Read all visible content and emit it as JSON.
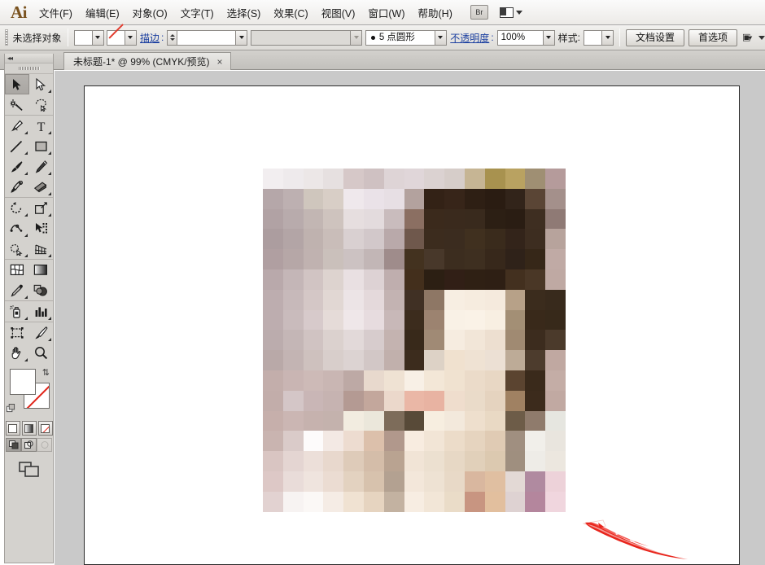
{
  "app": {
    "name": "Ai",
    "logo_text": "Ai"
  },
  "menubar": {
    "items": [
      {
        "label": "文件(F)",
        "name": "menu-file"
      },
      {
        "label": "编辑(E)",
        "name": "menu-edit"
      },
      {
        "label": "对象(O)",
        "name": "menu-object"
      },
      {
        "label": "文字(T)",
        "name": "menu-type"
      },
      {
        "label": "选择(S)",
        "name": "menu-select"
      },
      {
        "label": "效果(C)",
        "name": "menu-effect"
      },
      {
        "label": "视图(V)",
        "name": "menu-view"
      },
      {
        "label": "窗口(W)",
        "name": "menu-window"
      },
      {
        "label": "帮助(H)",
        "name": "menu-help"
      }
    ],
    "bridge_button": "Br",
    "arrange_documents_label": ""
  },
  "controlbar": {
    "selection_status": "未选择对象",
    "fill_label": "",
    "stroke_link_label": "描边",
    "stroke_weight_value": "",
    "variable_width_profile": "",
    "brush_definition": "5 点圆形",
    "opacity_link_label": "不透明度",
    "opacity_value": "100%",
    "style_label": "样式",
    "document_setup_button": "文档设置",
    "preferences_button": "首选项"
  },
  "tabbar": {
    "document_tab_title": "未标题-1* @ 99% (CMYK/预览)",
    "close_glyph": "×"
  },
  "toolpanel": {
    "tools": [
      {
        "name": "selection-tool",
        "icon": "arrow-solid",
        "active": true,
        "flyout": false
      },
      {
        "name": "direct-selection-tool",
        "icon": "arrow-outline",
        "active": false,
        "flyout": true
      },
      {
        "name": "magic-wand-tool",
        "icon": "magic-wand",
        "active": false,
        "flyout": false
      },
      {
        "name": "lasso-tool",
        "icon": "lasso",
        "active": false,
        "flyout": false
      },
      {
        "name": "pen-tool",
        "icon": "pen-nib",
        "active": false,
        "flyout": true
      },
      {
        "name": "type-tool",
        "icon": "type-T",
        "active": false,
        "flyout": true
      },
      {
        "name": "line-segment-tool",
        "icon": "line-diagonal",
        "active": false,
        "flyout": true
      },
      {
        "name": "rectangle-tool",
        "icon": "rectangle",
        "active": false,
        "flyout": true
      },
      {
        "name": "paintbrush-tool",
        "icon": "paintbrush",
        "active": false,
        "flyout": true
      },
      {
        "name": "pencil-tool",
        "icon": "pencil",
        "active": false,
        "flyout": true
      },
      {
        "name": "blob-brush-tool",
        "icon": "blob-brush",
        "active": false,
        "flyout": false
      },
      {
        "name": "eraser-tool",
        "icon": "eraser",
        "active": false,
        "flyout": true
      },
      {
        "name": "rotate-tool",
        "icon": "rotate",
        "active": false,
        "flyout": true
      },
      {
        "name": "scale-tool",
        "icon": "scale",
        "active": false,
        "flyout": true
      },
      {
        "name": "width-tool",
        "icon": "width-warp",
        "active": false,
        "flyout": true
      },
      {
        "name": "free-transform-tool",
        "icon": "free-transform",
        "active": false,
        "flyout": false
      },
      {
        "name": "shape-builder-tool",
        "icon": "shape-builder",
        "active": false,
        "flyout": true
      },
      {
        "name": "perspective-grid-tool",
        "icon": "perspective-grid",
        "active": false,
        "flyout": true
      },
      {
        "name": "mesh-tool",
        "icon": "mesh",
        "active": false,
        "flyout": false
      },
      {
        "name": "gradient-tool",
        "icon": "gradient",
        "active": false,
        "flyout": false
      },
      {
        "name": "eyedropper-tool",
        "icon": "eyedropper",
        "active": false,
        "flyout": true
      },
      {
        "name": "blend-tool",
        "icon": "blend-circles",
        "active": false,
        "flyout": false
      },
      {
        "name": "symbol-sprayer-tool",
        "icon": "symbol-sprayer",
        "active": false,
        "flyout": true
      },
      {
        "name": "column-graph-tool",
        "icon": "bar-graph",
        "active": false,
        "flyout": true
      },
      {
        "name": "artboard-tool",
        "icon": "artboard",
        "active": false,
        "flyout": false
      },
      {
        "name": "slice-tool",
        "icon": "slice-knife",
        "active": false,
        "flyout": true
      },
      {
        "name": "hand-tool",
        "icon": "hand",
        "active": false,
        "flyout": true
      },
      {
        "name": "zoom-tool",
        "icon": "magnifier",
        "active": false,
        "flyout": false
      }
    ],
    "fill_color": "#ffffff",
    "stroke_color": "none",
    "color_modes": [
      {
        "name": "color-mode-solid",
        "selected": true
      },
      {
        "name": "color-mode-gradient",
        "selected": false
      },
      {
        "name": "color-mode-none",
        "selected": false
      }
    ],
    "draw_modes": [
      {
        "name": "draw-normal-mode",
        "selected": true
      },
      {
        "name": "draw-behind-mode",
        "selected": false
      },
      {
        "name": "draw-inside-mode",
        "selected": false,
        "disabled": true
      }
    ],
    "screen_mode": "change-screen-mode"
  },
  "canvas": {
    "zoom_percent": "99%",
    "color_mode": "CMYK/预览",
    "artwork_description": "pixelated mosaic portrait",
    "brush_stroke_color": "#e8251c"
  },
  "mosaic": {
    "cols": 15,
    "rows": 17,
    "cell_w": 24.8,
    "cell_h": 24.8,
    "grid": [
      [
        "#f2eef0",
        "#eeeaec",
        "#ece7e7",
        "#e6e0e0",
        "#d6c8c8",
        "#cfc1c2",
        "#ded4d6",
        "#e0d6d9",
        "#dbd2d1",
        "#d6cdc9",
        "#c6b594",
        "#a8924f",
        "#b9a261",
        "#9f8f73",
        "#b59b9b"
      ],
      [
        "#b5a7a9",
        "#bdb0b1",
        "#cfc6bd",
        "#d8cec6",
        "#efe8ec",
        "#eae2e8",
        "#e7dfe4",
        "#b3a29e",
        "#332216",
        "#372519",
        "#2e1f14",
        "#2a1c12",
        "#32241a",
        "#5a4535",
        "#a4908b"
      ],
      [
        "#b1a2a4",
        "#b8abac",
        "#c2b6b3",
        "#cec3be",
        "#e6dedf",
        "#e3dbdd",
        "#c9bcbd",
        "#8b6f62",
        "#3b2a1c",
        "#3a2a1d",
        "#392a1d",
        "#2c1f14",
        "#2a1d13",
        "#3e2e21",
        "#8f7a75"
      ],
      [
        "#ac9d9f",
        "#b3a5a6",
        "#bfb2af",
        "#c9bdb9",
        "#d9d0d1",
        "#d2c8ca",
        "#b9a9aa",
        "#6f584c",
        "#3c2c1e",
        "#3b2c1f",
        "#40301f",
        "#3a2b1c",
        "#33241a",
        "#3d2d20",
        "#b7a39c"
      ],
      [
        "#b09fa1",
        "#b6a7a7",
        "#c0b2b0",
        "#cac0bb",
        "#ccc2c2",
        "#c2b6b6",
        "#9f8c8b",
        "#43321f",
        "#48382a",
        "#3c2d1f",
        "#3e2f20",
        "#37281b",
        "#2f2219",
        "#362718",
        "#c0aaa5"
      ],
      [
        "#b9a9ab",
        "#c4b6b7",
        "#d1c4c3",
        "#ddd3cf",
        "#e9e0e2",
        "#ddd2d4",
        "#bfaeae",
        "#432f1c",
        "#2c1f13",
        "#311f16",
        "#2f2014",
        "#2e1f14",
        "#43301f",
        "#4a3726",
        "#bfa9a3"
      ],
      [
        "#bdadaf",
        "#c7b9ba",
        "#d4c7c6",
        "#e1d7d3",
        "#ece4e6",
        "#e4d9db",
        "#c3b3b2",
        "#403024",
        "#8e7765",
        "#f7eee2",
        "#f6ecdf",
        "#f5eadd",
        "#b7a188",
        "#3b2c1d",
        "#382a1c"
      ],
      [
        "#bdadaf",
        "#c9bbbc",
        "#d7cacb",
        "#e5dbd8",
        "#efe7e9",
        "#e7dcdf",
        "#c8b8b8",
        "#3c2c1d",
        "#9c8370",
        "#f9f1e6",
        "#faf2e7",
        "#f8efe2",
        "#a38f75",
        "#39291a",
        "#37291a"
      ],
      [
        "#bbacad",
        "#c4b6b6",
        "#d0c3c2",
        "#dbd1ce",
        "#e2d9d9",
        "#d7cccd",
        "#c4b3b0",
        "#38291a",
        "#a08a75",
        "#f6ece0",
        "#f2e6d8",
        "#eddfd0",
        "#a08a72",
        "#3c2c1e",
        "#4b3a2b"
      ],
      [
        "#b9a9a8",
        "#c3b4b3",
        "#cec1be",
        "#d8cecb",
        "#dcd3d2",
        "#d2c7c6",
        "#c1b0ac",
        "#3c2c1d",
        "#ddd2c6",
        "#f0e1cf",
        "#efe2d3",
        "#ece0d4",
        "#bdab97",
        "#4d3c2d",
        "#c0a8a1"
      ],
      [
        "#c3aeab",
        "#c9b5b3",
        "#cdbab7",
        "#c9b6b3",
        "#bda9a5",
        "#e8d9cd",
        "#efe2d3",
        "#f8f0e6",
        "#f3e7d7",
        "#f0e2d0",
        "#ebdbc9",
        "#e8d7c4",
        "#5b4430",
        "#3a2a1b",
        "#c4ada6"
      ],
      [
        "#c2adaa",
        "#d4c6c7",
        "#c9b6b6",
        "#c6b3b1",
        "#b49a93",
        "#c3a79c",
        "#ebd8cb",
        "#eab7a6",
        "#e8b3a2",
        "#efddcd",
        "#eadbc9",
        "#e5d3bf",
        "#a08162",
        "#3c2b1c",
        "#c1a9a2"
      ],
      [
        "#c6afab",
        "#cbb6b3",
        "#c6b2ae",
        "#c4b2ad",
        "#f2ece0",
        "#ebe7db",
        "#7d6c5a",
        "#584a38",
        "#f7eee0",
        "#f3e9dc",
        "#eedfcd",
        "#e9d9c4",
        "#6d5c48",
        "#8f7b6c",
        "#e6e6e0"
      ],
      [
        "#c9b4b0",
        "#dacbc9",
        "#fdfbfb",
        "#f3e9e4",
        "#eddcd0",
        "#dcc0ab",
        "#b1988c",
        "#f8ece0",
        "#f2e5d6",
        "#ecdcc9",
        "#e6d4bf",
        "#e0cbb4",
        "#a08f80",
        "#f1efea",
        "#e9e5de"
      ],
      [
        "#d9c5c2",
        "#e4d5d2",
        "#ecdfd9",
        "#e8d8cd",
        "#decbb9",
        "#d4bda9",
        "#b9a391",
        "#f1e4d6",
        "#ece0d0",
        "#e7d8c5",
        "#e1d0ba",
        "#dcc9b0",
        "#9f8f7f",
        "#eeece7",
        "#ece7df"
      ],
      [
        "#ddc8c6",
        "#e9dcd9",
        "#efe4de",
        "#ebdcd2",
        "#e3d2c0",
        "#d7c2ad",
        "#b3a191",
        "#f3e7da",
        "#eee2d3",
        "#e8d9c7",
        "#d9b79f",
        "#e0bfa1",
        "#e3d9d5",
        "#b08aa0",
        "#edd2d9"
      ],
      [
        "#e2d2d1",
        "#f7f3f2",
        "#fbf8f6",
        "#f5ece5",
        "#f0e2d2",
        "#e6d4c0",
        "#c3b2a1",
        "#f7ede2",
        "#f2e6d7",
        "#eadcc8",
        "#c89581",
        "#e2bf9e",
        "#ded2d2",
        "#b4869d",
        "#f0d6de"
      ]
    ]
  }
}
